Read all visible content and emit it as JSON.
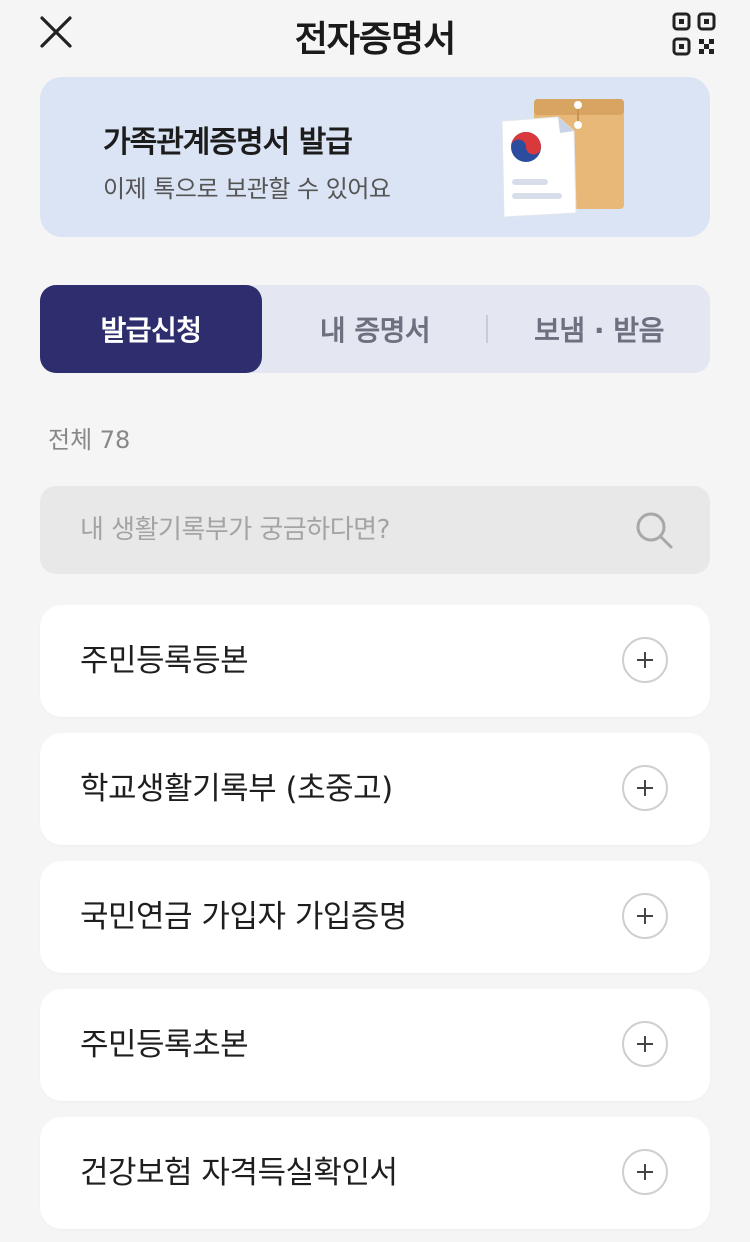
{
  "header": {
    "title": "전자증명서",
    "close_icon": "close-icon",
    "qr_icon": "qr-code-icon"
  },
  "banner": {
    "title": "가족관계증명서 발급",
    "subtitle": "이제 톡으로 보관할 수 있어요",
    "illustration": "document-envelope-illustration"
  },
  "tabs": [
    {
      "label": "발급신청",
      "active": true
    },
    {
      "label": "내 증명서",
      "active": false
    },
    {
      "label": "보냄 · 받음",
      "active": false
    }
  ],
  "total_label": "전체 78",
  "search": {
    "placeholder": "내 생활기록부가 궁금하다면?",
    "icon": "search-icon"
  },
  "items": [
    {
      "label": "주민등록등본"
    },
    {
      "label": "학교생활기록부 (초중고)"
    },
    {
      "label": "국민연금 가입자 가입증명"
    },
    {
      "label": "주민등록초본"
    },
    {
      "label": "건강보험 자격득실확인서"
    }
  ],
  "colors": {
    "background": "#f5f5f5",
    "banner_bg": "#dae4f4",
    "tab_active": "#2e2e6e",
    "tab_bg": "#e4e6f1"
  }
}
